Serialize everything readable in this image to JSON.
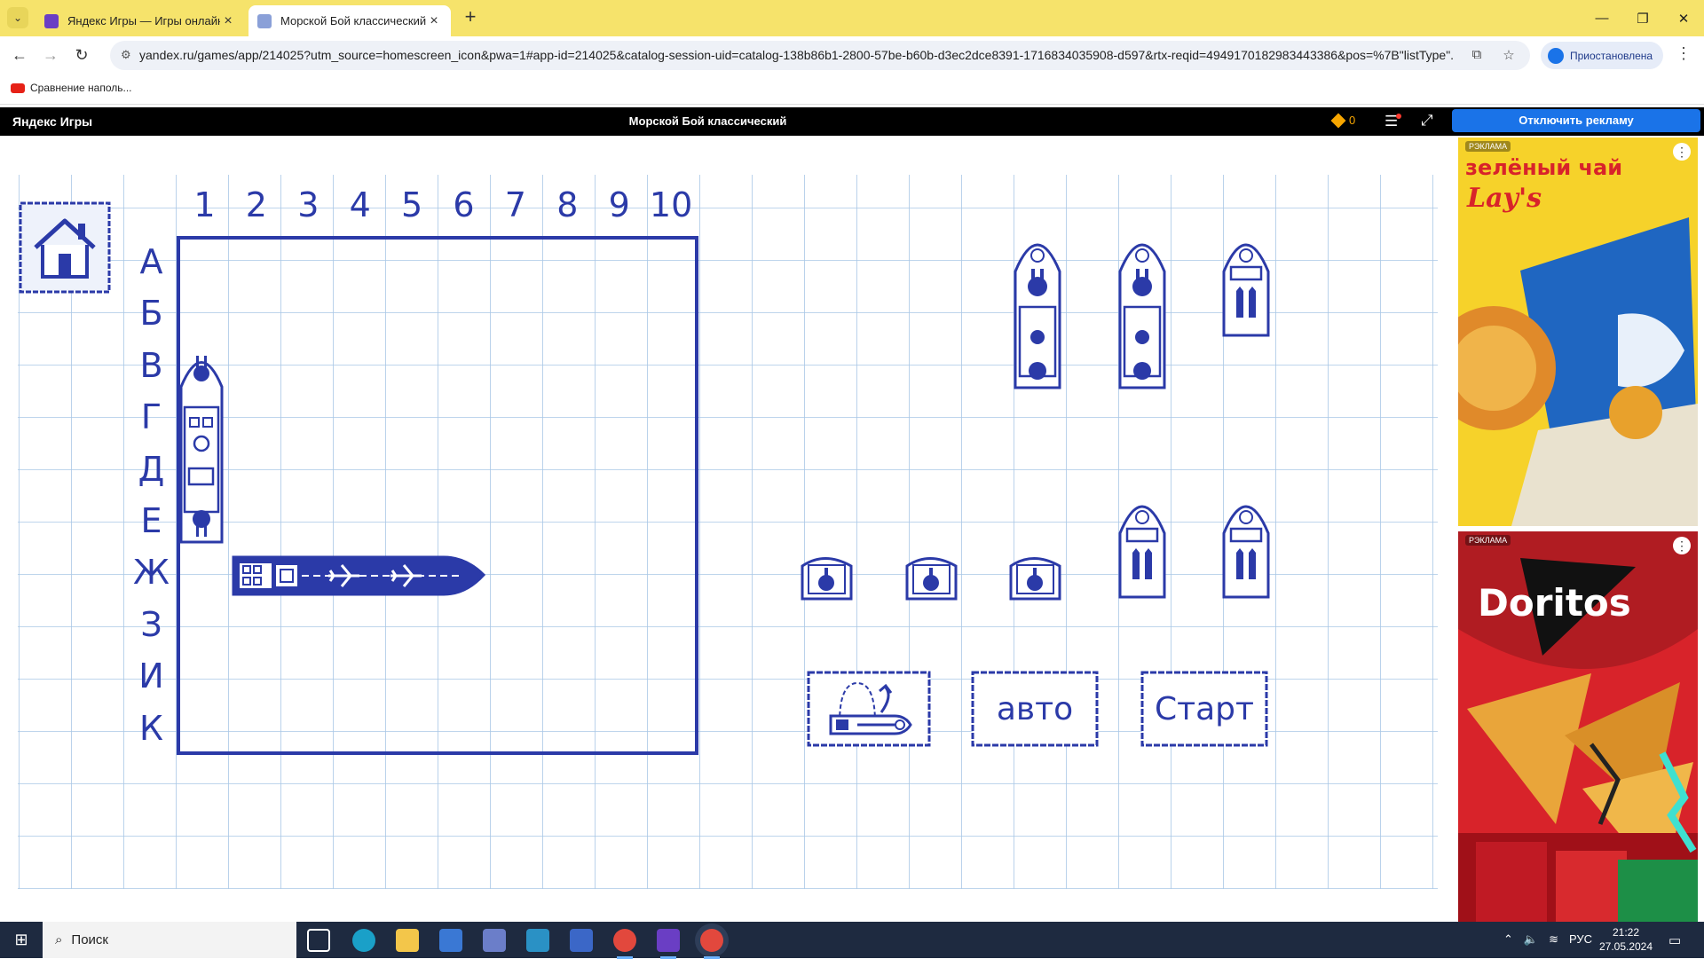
{
  "browser": {
    "tabs": [
      {
        "title": "Яндекс Игры — Игры онлайн",
        "active": false
      },
      {
        "title": "Морской Бой классический - ",
        "active": true
      }
    ],
    "url": "yandex.ru/games/app/214025?utm_source=homescreen_icon&pwa=1#app-id=214025&catalog-session-uid=catalog-138b86b1-2800-57be-b60b-d3ec2dce8391-1716834035908-d597&rtx-reqid=4949170182983443386&pos=%7B\"listType\"...",
    "profile_label": "Приостановлена",
    "bookmark": "Сравнение наполь..."
  },
  "yandex_bar": {
    "logo": "Яндекс Игры",
    "game_title": "Морской Бой классический",
    "coins": "0",
    "remove_ads": "Отключить рекламу"
  },
  "board": {
    "columns": [
      "1",
      "2",
      "3",
      "4",
      "5",
      "6",
      "7",
      "8",
      "9",
      "10"
    ],
    "rows": [
      "А",
      "Б",
      "В",
      "Г",
      "Д",
      "Е",
      "Ж",
      "З",
      "И",
      "К"
    ],
    "placed_ships": [
      {
        "size": 4,
        "orientation": "vertical",
        "col": 1,
        "row_start": "В",
        "row_end": "Е"
      },
      {
        "size": 4,
        "orientation": "horizontal",
        "row": "Ж",
        "col_start": 2,
        "col_end": 6
      }
    ]
  },
  "dock": {
    "ships": [
      {
        "size": 3,
        "label": "cruiser"
      },
      {
        "size": 3,
        "label": "cruiser"
      },
      {
        "size": 2,
        "label": "destroyer"
      },
      {
        "size": 2,
        "label": "destroyer"
      },
      {
        "size": 2,
        "label": "destroyer"
      },
      {
        "size": 1,
        "label": "boat"
      },
      {
        "size": 1,
        "label": "boat"
      },
      {
        "size": 1,
        "label": "boat"
      }
    ]
  },
  "buttons": {
    "rotate_icon": "rotate-ship-icon",
    "auto": "авто",
    "start": "Старт"
  },
  "ads": [
    {
      "label": "РЭКЛАМА",
      "brand": "Lay's",
      "text": "зелёный чай",
      "color": "#f6d22a"
    },
    {
      "label": "РЭКЛАМА",
      "brand": "Doritos",
      "color": "#d8232a"
    }
  ],
  "taskbar": {
    "search_placeholder": "Поиск",
    "lang": "РУС",
    "time": "21:22",
    "date": "27.05.2024"
  },
  "colors": {
    "ink": "#2b3aa8",
    "grid": "#a9c7e6",
    "tab_bar": "#f6e36b",
    "accent": "#1a73e8"
  }
}
